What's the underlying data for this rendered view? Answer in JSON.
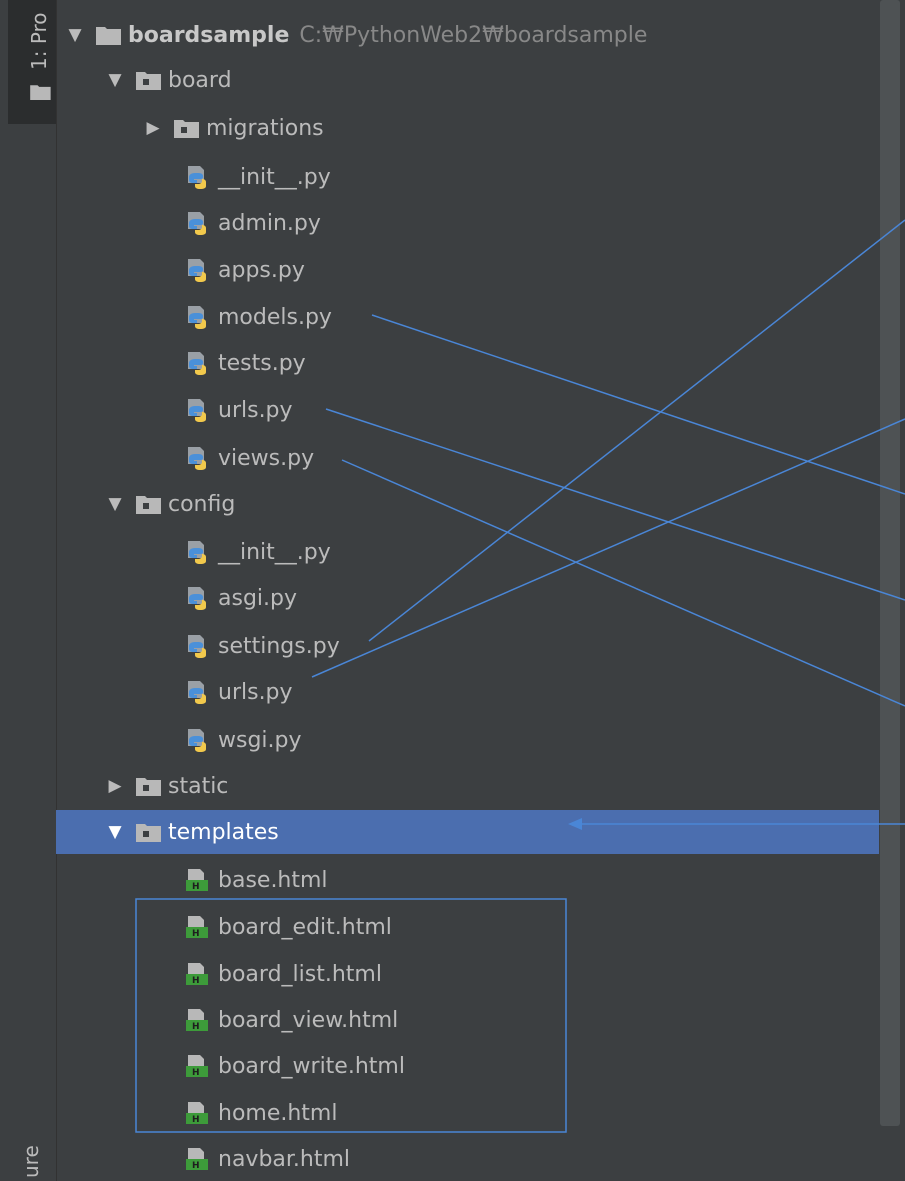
{
  "sidebar": {
    "project_tab_label": "1: Pro",
    "structure_tab_label": "ure"
  },
  "root": {
    "name": "boardsample",
    "path": "C:₩PythonWeb2₩boardsample"
  },
  "tree": {
    "board": {
      "label": "board",
      "migrations": "migrations",
      "files": [
        "__init__.py",
        "admin.py",
        "apps.py",
        "models.py",
        "tests.py",
        "urls.py",
        "views.py"
      ]
    },
    "config": {
      "label": "config",
      "files": [
        "__init__.py",
        "asgi.py",
        "settings.py",
        "urls.py",
        "wsgi.py"
      ]
    },
    "static": {
      "label": "static"
    },
    "templates": {
      "label": "templates",
      "files": [
        "base.html",
        "board_edit.html",
        "board_list.html",
        "board_view.html",
        "board_write.html",
        "home.html",
        "navbar.html"
      ]
    }
  },
  "colors": {
    "background": "#3c3f41",
    "selection": "#4b6eaf",
    "annotation": "#4a86d6",
    "text": "#bbbbbb",
    "html_icon": "#3d9b3a"
  }
}
